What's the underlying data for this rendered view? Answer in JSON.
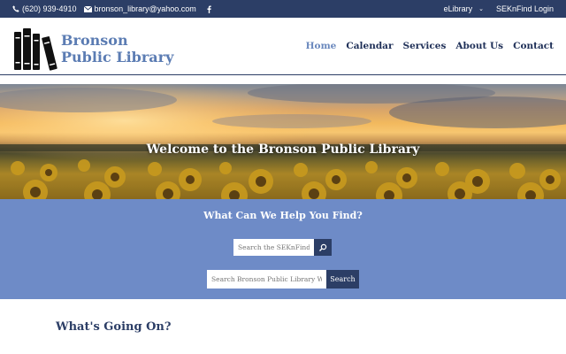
{
  "topbar": {
    "phone": "(620) 939-4910",
    "email": "bronson_library@yahoo.com",
    "elibrary_label": "eLibrary",
    "sekn_label": "SEKnFind Login"
  },
  "logo": {
    "line1": "Bronson",
    "line2": "Public Library"
  },
  "nav": {
    "items": [
      {
        "label": "Home",
        "active": true
      },
      {
        "label": "Calendar",
        "active": false
      },
      {
        "label": "Services",
        "active": false
      },
      {
        "label": "About Us",
        "active": false
      },
      {
        "label": "Contact",
        "active": false
      }
    ]
  },
  "hero": {
    "title": "Welcome to the Bronson Public Library"
  },
  "search": {
    "heading": "What Can We Help You Find?",
    "catalog_placeholder": "Search the SEKnFind Catalog",
    "site_placeholder": "Search Bronson Public Library Website",
    "site_button": "Search"
  },
  "section": {
    "heading": "What's Going On?"
  },
  "colors": {
    "topbar": "#2c3e66",
    "brand": "#5b7cb3",
    "band": "#6e8bc7",
    "nav_text": "#1e2f57"
  },
  "icons": {
    "phone": "phone-icon",
    "email": "envelope-icon",
    "facebook": "facebook-icon",
    "search": "magnifier-icon",
    "chevron": "chevron-down-icon"
  }
}
